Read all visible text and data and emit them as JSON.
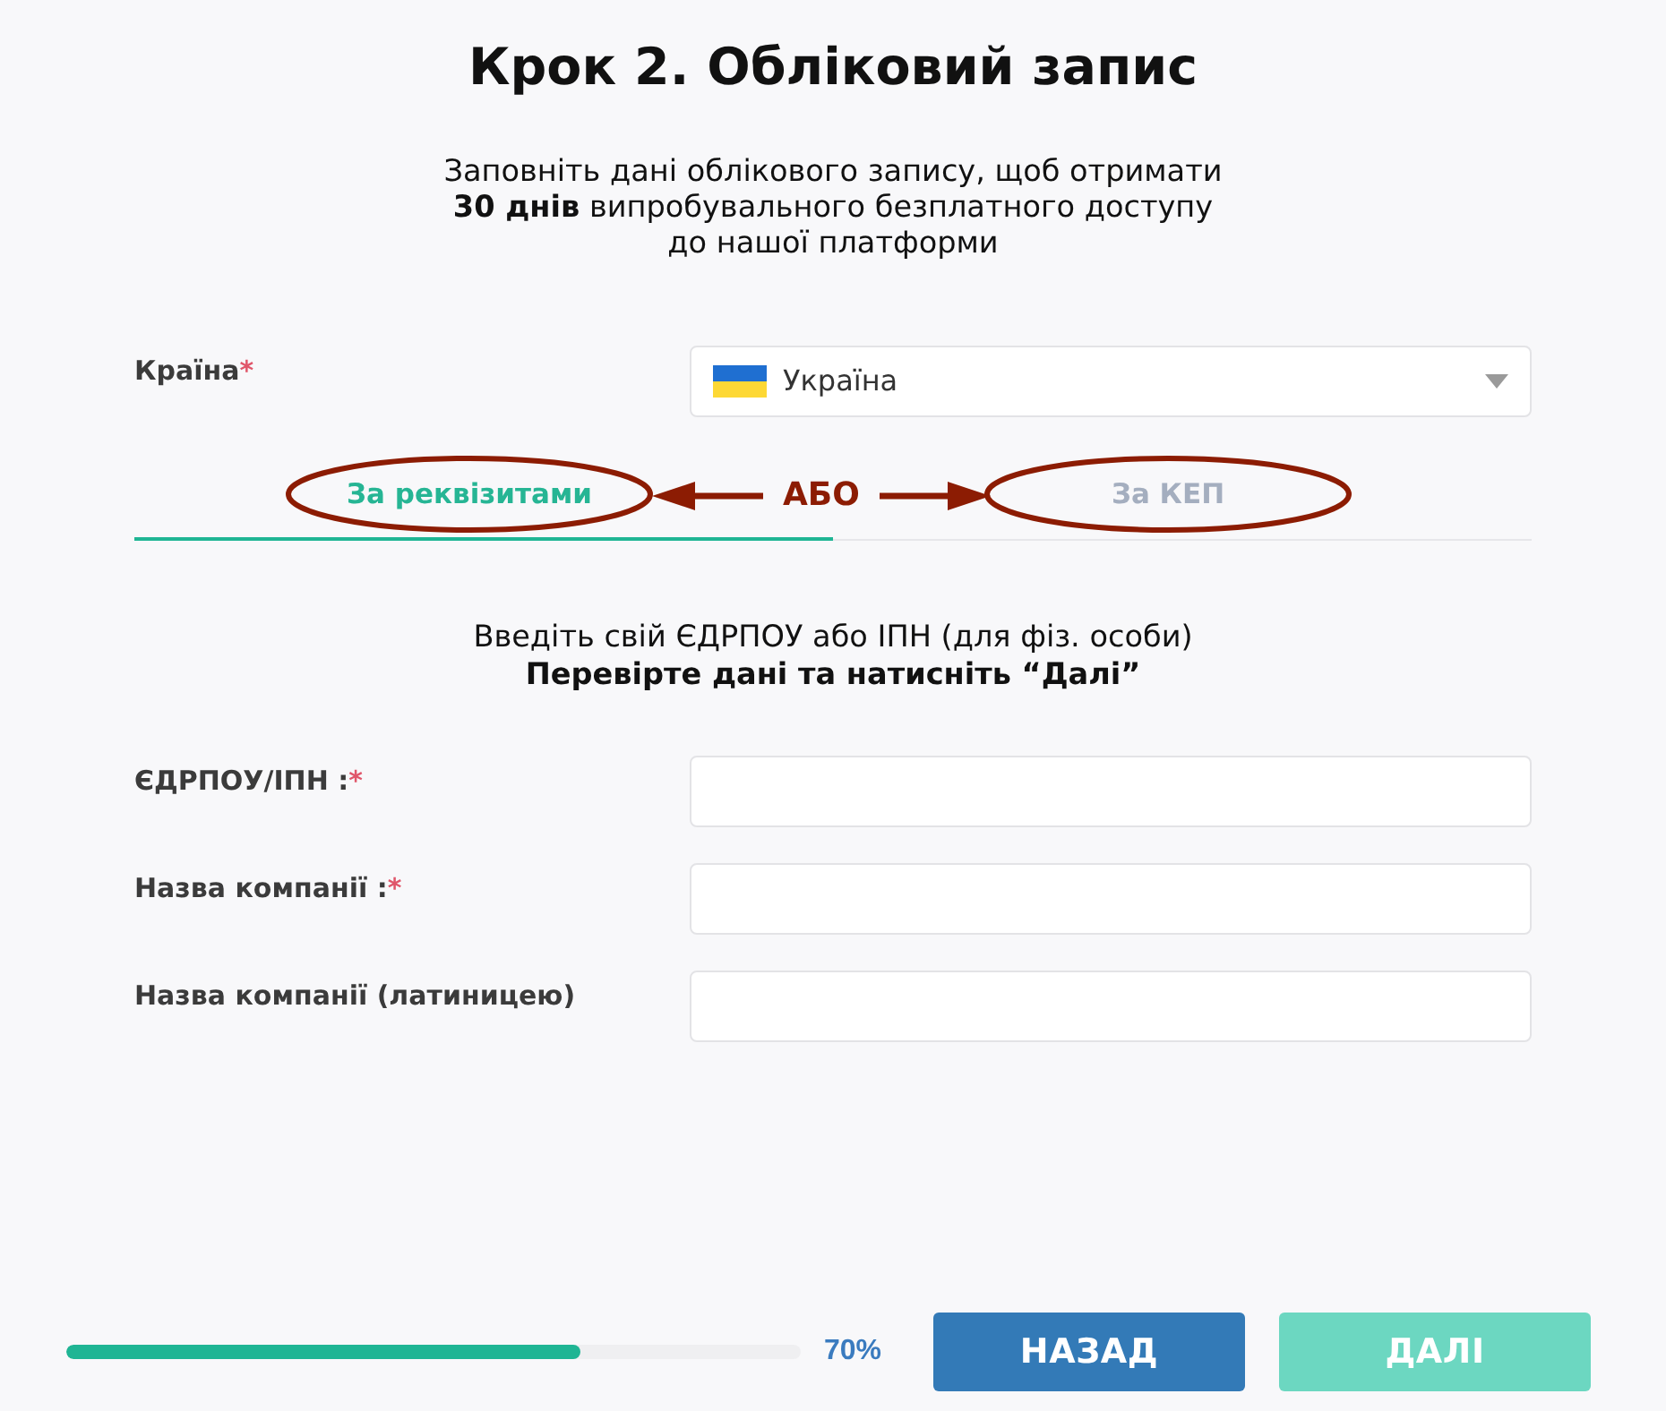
{
  "title": "Крок 2. Обліковий запис",
  "intro": "Заповніть дані облікового запису, щоб отримати **30 днів** випробувального безплатного доступу до нашої платформи",
  "country": {
    "label": "Країна",
    "required_mark": "*",
    "value": "Україна"
  },
  "tabs": [
    {
      "label": "За реквізитами",
      "selected": true,
      "circled": true
    },
    {
      "label": "За КЕП",
      "selected": false,
      "circled": true
    }
  ],
  "annotation": {
    "label": "АБО"
  },
  "instructions": [
    {
      "kind": "plain",
      "text": "Введіть свій ЄДРПОУ або ІПН (для фіз. особи)"
    },
    {
      "kind": "bold",
      "text": "Перевірте дані та натисніть “Далі”"
    }
  ],
  "fields": [
    {
      "label": "ЄДРПОУ/ІПН :",
      "required_mark": "*"
    },
    {
      "label": "Назва компанії :",
      "required_mark": "*"
    },
    {
      "label": "Назва компанії (латиницею)"
    }
  ],
  "progress": {
    "level": 0.7,
    "reading": "70%"
  },
  "buttons": [
    {
      "label": "НАЗАД",
      "disabled": false
    },
    {
      "label": "ДАЛІ",
      "disabled": true
    }
  ]
}
